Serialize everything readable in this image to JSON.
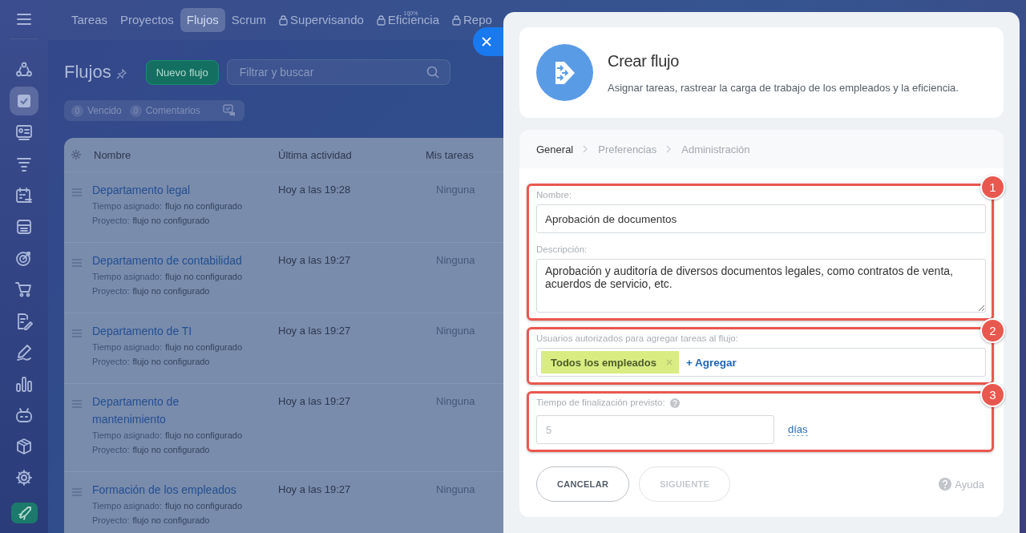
{
  "sidebar": {
    "items": [
      {
        "selected": false
      },
      {
        "selected": true
      },
      {
        "selected": false
      },
      {
        "selected": false
      },
      {
        "selected": false
      },
      {
        "selected": false
      },
      {
        "selected": false
      },
      {
        "selected": false
      },
      {
        "selected": false
      },
      {
        "selected": false
      },
      {
        "selected": false
      },
      {
        "selected": false
      },
      {
        "selected": false
      },
      {
        "selected": false
      }
    ]
  },
  "top_tabs": [
    {
      "label": "Tareas",
      "selected": false,
      "locked": false
    },
    {
      "label": "Proyectos",
      "selected": false,
      "locked": false
    },
    {
      "label": "Flujos",
      "selected": true,
      "locked": false
    },
    {
      "label": "Scrum",
      "selected": false,
      "locked": false
    },
    {
      "label": "Supervisando",
      "selected": false,
      "locked": true
    },
    {
      "label": "Eficiencia",
      "selected": false,
      "locked": true,
      "badge": "100%"
    },
    {
      "label": "Repo",
      "selected": false,
      "locked": true
    }
  ],
  "page": {
    "title": "Flujos",
    "new_button": "Nuevo flujo",
    "search": {
      "placeholder": "Filtrar y buscar"
    },
    "counters": [
      {
        "count": "0",
        "label": "Vencido"
      },
      {
        "count": "0",
        "label": "Comentarios"
      }
    ]
  },
  "table": {
    "columns": [
      "Nombre",
      "Última actividad",
      "Mis tareas"
    ],
    "rows": [
      {
        "name": "Departamento legal",
        "time_label": "Tiempo asignado:",
        "time_value": "flujo no configurado",
        "project_label": "Proyecto:",
        "project_value": "flujo no configurado",
        "last_activity": "Hoy a las 19:28",
        "my_tasks": "Ninguna"
      },
      {
        "name": "Departamento de contabilidad",
        "time_label": "Tiempo asignado:",
        "time_value": "flujo no configurado",
        "project_label": "Proyecto:",
        "project_value": "flujo no configurado",
        "last_activity": "Hoy a las 19:27",
        "my_tasks": "Ninguna"
      },
      {
        "name": "Departamento de TI",
        "time_label": "Tiempo asignado:",
        "time_value": "flujo no configurado",
        "project_label": "Proyecto:",
        "project_value": "flujo no configurado",
        "last_activity": "Hoy a las 19:27",
        "my_tasks": "Ninguna"
      },
      {
        "name": "Departamento de mantenimiento",
        "time_label": "Tiempo asignado:",
        "time_value": "flujo no configurado",
        "project_label": "Proyecto:",
        "project_value": "flujo no configurado",
        "last_activity": "Hoy a las 19:27",
        "my_tasks": "Ninguna"
      },
      {
        "name": "Formación de los empleados",
        "time_label": "Tiempo asignado:",
        "time_value": "flujo no configurado",
        "project_label": "Proyecto:",
        "project_value": "flujo no configurado",
        "last_activity": "Hoy a las 19:27",
        "my_tasks": "Ninguna"
      }
    ]
  },
  "panel": {
    "title": "Crear flujo",
    "subtitle": "Asignar tareas, rastrear la carga de trabajo de los empleados y la eficiencia.",
    "steps": [
      {
        "label": "General",
        "selected": true
      },
      {
        "label": "Preferencias",
        "selected": false
      },
      {
        "label": "Administración",
        "selected": false
      }
    ],
    "sections": [
      {
        "number": "1",
        "fields": [
          {
            "kind": "input",
            "label": "Nombre:",
            "value": "Aprobación de documentos"
          },
          {
            "kind": "textarea",
            "label": "Descripción:",
            "value": "Aprobación y auditoría de diversos documentos legales, como contratos de venta, acuerdos de servicio, etc."
          }
        ]
      },
      {
        "number": "2",
        "fields": [
          {
            "kind": "tags",
            "label": "Usuarios autorizados para agregar tareas al flujo:",
            "tags": [
              "Todos los empleados"
            ],
            "add": "+ Agregar"
          }
        ]
      },
      {
        "number": "3",
        "fields": [
          {
            "kind": "duration",
            "label": "Tiempo de finalización previsto:",
            "placeholder": "5",
            "unit": "días"
          }
        ]
      }
    ],
    "buttons": [
      {
        "label": "CANCELAR",
        "disabled": false
      },
      {
        "label": "SIGUIENTE",
        "disabled": true
      }
    ],
    "help": "Ayuda"
  }
}
